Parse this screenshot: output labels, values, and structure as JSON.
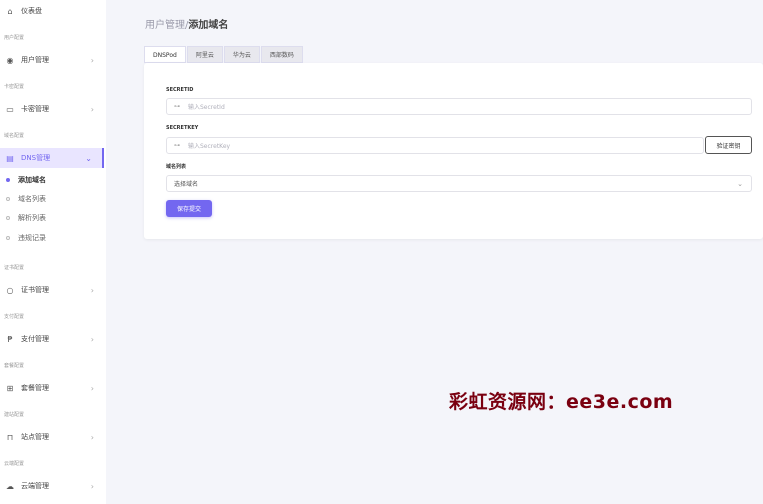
{
  "sidebar": {
    "dashboard": "仪表盘",
    "groups": {
      "users": "用户配置",
      "cards": "卡密配置",
      "domains": "域名配置",
      "certs": "证书配置",
      "payment": "支付配置",
      "plans": "套餐配置",
      "sites": "建站配置",
      "cloud": "云端配置"
    },
    "items": {
      "user_mgmt": "用户管理",
      "card_mgmt": "卡密管理",
      "dns_mgmt": "DNS管理",
      "cert_mgmt": "证书管理",
      "pay_mgmt": "支付管理",
      "plan_mgmt": "套餐管理",
      "site_mgmt": "站点管理",
      "cloud_mgmt": "云端管理"
    },
    "dns_sub": [
      "添加域名",
      "域名列表",
      "解析列表",
      "违规记录"
    ]
  },
  "header": {
    "crumb": "用户管理/",
    "title": "添加域名"
  },
  "tabs": [
    "DNSPod",
    "阿里云",
    "华为云",
    "西部数码"
  ],
  "form": {
    "secretid_label": "SECRETID",
    "secretid_placeholder": "输入SecretId",
    "secretkey_label": "SECRETKEY",
    "secretkey_placeholder": "输入SecretKey",
    "verify_button": "验证密钥",
    "domain_list_label": "域名列表",
    "domain_select": "选择域名",
    "save_button": "保存提交"
  },
  "watermark": "彩虹资源网：ee3e.com",
  "colors": {
    "accent": "#7367f0",
    "watermark": "#7a0010"
  }
}
